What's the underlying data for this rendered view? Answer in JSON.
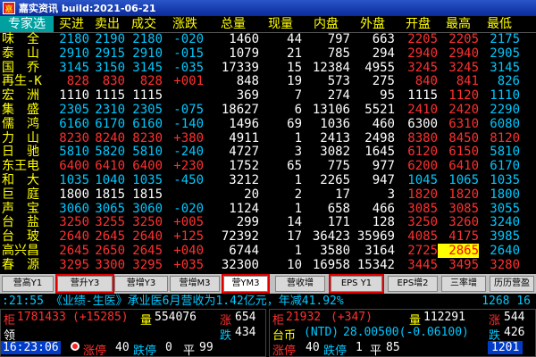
{
  "window": {
    "title": "嘉实资讯 build:2021-06-21"
  },
  "header": [
    "专家选",
    "买进",
    "卖出",
    "成交",
    "涨跌",
    "总量",
    "现量",
    "内盘",
    "外盘",
    "开盘",
    "最高",
    "最低"
  ],
  "rows": [
    {
      "name": "味　全",
      "bid": "2180",
      "ask": "2190",
      "last": "2180",
      "chg": "-020",
      "vol": "1460",
      "cur": "44",
      "inner": "797",
      "outer": "663",
      "open": "2205",
      "high": "2205",
      "low": "2175",
      "tone": "dn",
      "open_tone": "up",
      "high_tone": "up",
      "low_tone": "dn"
    },
    {
      "name": "泰　山",
      "bid": "2910",
      "ask": "2915",
      "last": "2910",
      "chg": "-015",
      "vol": "1079",
      "cur": "21",
      "inner": "785",
      "outer": "294",
      "open": "2940",
      "high": "2940",
      "low": "2905",
      "tone": "dn",
      "open_tone": "up",
      "high_tone": "up",
      "low_tone": "dn"
    },
    {
      "name": "国　乔",
      "bid": "3145",
      "ask": "3150",
      "last": "3145",
      "chg": "-035",
      "vol": "17339",
      "cur": "15",
      "inner": "12384",
      "outer": "4955",
      "open": "3245",
      "high": "3245",
      "low": "3145",
      "tone": "dn",
      "open_tone": "up",
      "high_tone": "up",
      "low_tone": "dn"
    },
    {
      "name": "再生-K",
      "bid": "828",
      "ask": "830",
      "last": "828",
      "chg": "+001",
      "vol": "848",
      "cur": "19",
      "inner": "573",
      "outer": "275",
      "open": "840",
      "high": "841",
      "low": "826",
      "tone": "up",
      "open_tone": "up",
      "high_tone": "up",
      "low_tone": "dn"
    },
    {
      "name": "宏　洲",
      "bid": "1110",
      "ask": "1115",
      "last": "1115",
      "chg": "",
      "vol": "369",
      "cur": "7",
      "inner": "274",
      "outer": "95",
      "open": "1115",
      "high": "1120",
      "low": "1110",
      "tone": "eq",
      "open_tone": "eq",
      "high_tone": "up",
      "low_tone": "dn"
    },
    {
      "name": "集　盛",
      "bid": "2305",
      "ask": "2310",
      "last": "2305",
      "chg": "-075",
      "vol": "18627",
      "cur": "6",
      "inner": "13106",
      "outer": "5521",
      "open": "2410",
      "high": "2420",
      "low": "2290",
      "tone": "dn",
      "open_tone": "up",
      "high_tone": "up",
      "low_tone": "dn"
    },
    {
      "name": "儒　鸿",
      "bid": "6160",
      "ask": "6170",
      "last": "6160",
      "chg": "-140",
      "vol": "1496",
      "cur": "69",
      "inner": "1036",
      "outer": "460",
      "open": "6300",
      "high": "6310",
      "low": "6080",
      "tone": "dn",
      "open_tone": "w",
      "high_tone": "up",
      "low_tone": "dn"
    },
    {
      "name": "力　山",
      "bid": "8230",
      "ask": "8240",
      "last": "8230",
      "chg": "+380",
      "vol": "4911",
      "cur": "1",
      "inner": "2413",
      "outer": "2498",
      "open": "8380",
      "high": "8450",
      "low": "8120",
      "tone": "up",
      "open_tone": "up",
      "high_tone": "up",
      "low_tone": "up"
    },
    {
      "name": "日　驰",
      "bid": "5810",
      "ask": "5820",
      "last": "5810",
      "chg": "-240",
      "vol": "4727",
      "cur": "3",
      "inner": "3082",
      "outer": "1645",
      "open": "6120",
      "high": "6150",
      "low": "5810",
      "tone": "dn",
      "open_tone": "up",
      "high_tone": "up",
      "low_tone": "dn"
    },
    {
      "name": "东王电",
      "bid": "6400",
      "ask": "6410",
      "last": "6400",
      "chg": "+230",
      "vol": "1752",
      "cur": "65",
      "inner": "775",
      "outer": "977",
      "open": "6200",
      "high": "6410",
      "low": "6170",
      "tone": "up",
      "open_tone": "up",
      "high_tone": "up",
      "low_tone": "dn"
    },
    {
      "name": "和　大",
      "bid": "1035",
      "ask": "1040",
      "last": "1035",
      "chg": "-450",
      "vol": "3212",
      "cur": "1",
      "inner": "2265",
      "outer": "947",
      "open": "1045",
      "high": "1065",
      "low": "1035",
      "tone": "dn",
      "open_tone": "dn",
      "high_tone": "dn",
      "low_tone": "dn"
    },
    {
      "name": "巨　庭",
      "bid": "1800",
      "ask": "1815",
      "last": "1815",
      "chg": "",
      "vol": "20",
      "cur": "2",
      "inner": "17",
      "outer": "3",
      "open": "1820",
      "high": "1820",
      "low": "1800",
      "tone": "eq",
      "open_tone": "up",
      "high_tone": "up",
      "low_tone": "dn"
    },
    {
      "name": "声　宝",
      "bid": "3060",
      "ask": "3065",
      "last": "3060",
      "chg": "-020",
      "vol": "1124",
      "cur": "1",
      "inner": "658",
      "outer": "466",
      "open": "3085",
      "high": "3085",
      "low": "3055",
      "tone": "dn",
      "open_tone": "up",
      "high_tone": "up",
      "low_tone": "dn"
    },
    {
      "name": "台　盐",
      "bid": "3250",
      "ask": "3255",
      "last": "3250",
      "chg": "+005",
      "vol": "299",
      "cur": "14",
      "inner": "171",
      "outer": "128",
      "open": "3250",
      "high": "3260",
      "low": "3240",
      "tone": "up",
      "open_tone": "up",
      "high_tone": "up",
      "low_tone": "dn"
    },
    {
      "name": "台　玻",
      "bid": "2640",
      "ask": "2645",
      "last": "2640",
      "chg": "+125",
      "vol": "72392",
      "cur": "17",
      "inner": "36423",
      "outer": "35969",
      "open": "4085",
      "high": "4175",
      "low": "3985",
      "tone": "up",
      "open_tone": "up",
      "high_tone": "up",
      "low_tone": "dn"
    },
    {
      "name": "高兴昌",
      "bid": "2645",
      "ask": "2650",
      "last": "2645",
      "chg": "+040",
      "vol": "6744",
      "cur": "1",
      "inner": "3580",
      "outer": "3164",
      "open": "2725",
      "high": "2865",
      "low": "2640",
      "tone": "up",
      "open_tone": "up",
      "high_tone": "up",
      "low_tone": "dn",
      "high_hl": true
    },
    {
      "name": "春　源",
      "bid": "3295",
      "ask": "3300",
      "last": "3295",
      "chg": "+035",
      "vol": "32300",
      "cur": "10",
      "inner": "16958",
      "outer": "15342",
      "open": "3445",
      "high": "3495",
      "low": "3280",
      "tone": "up",
      "open_tone": "up",
      "high_tone": "up",
      "low_tone": "up"
    }
  ],
  "tabs": [
    "营高Y1",
    "营升Y3",
    "营增Y3",
    "营增M3",
    "营YM3",
    "营收增",
    "EPS Y1",
    "EPS增2",
    "三率增",
    "历历营盈"
  ],
  "active_tab": "营YM3",
  "ticker": {
    "text": ":21:55 《业绩-生医》承业医6月营收为1.42亿元，年减41.92%",
    "right": "1268 16"
  },
  "bottom": {
    "left": {
      "line1_label": "柜",
      "line1_val": "1781433",
      "line1_chg": "(+15285)",
      "line1_vol_label": "量",
      "line1_vol": "554076",
      "line1_up_label": "涨",
      "line1_up": "654",
      "line2_label": "领",
      "line2_dn_label": "跌",
      "line2_dn": "434",
      "time": "16:23:06",
      "stop_label": "涨停",
      "stop": "40",
      "dnstop_label": "跌停",
      "dnstop": "0",
      "flat_label": "平",
      "flat": "99"
    },
    "right": {
      "line1_label": "柜",
      "line1_val": "21932",
      "line1_chg": "(+347)",
      "line1_vol_label": "量",
      "line1_vol": "112291",
      "line1_up_label": "涨",
      "line1_up": "544",
      "line2_label": "台币",
      "line2_val": "(NTD)",
      "line2_num": "28.00500(-0.06100)",
      "line2_dn_label": "跌",
      "line2_dn": "426",
      "stop_label": "涨停",
      "stop": "40",
      "dnstop_label": "跌停",
      "dnstop": "1",
      "flat_label": "平",
      "flat": "85",
      "count": "1201"
    }
  },
  "colors": {
    "up": "#ff3030",
    "down": "#00c8ff",
    "header": "#ffff00",
    "highlight_box": "#e00000"
  }
}
